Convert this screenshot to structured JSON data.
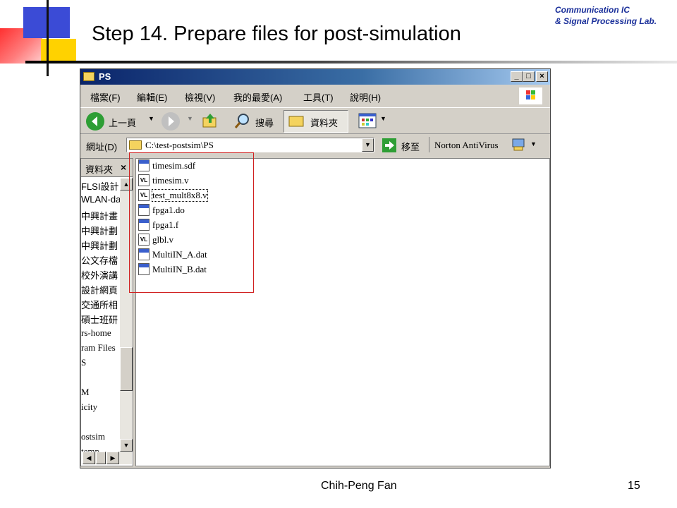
{
  "slide": {
    "title": "Step 14.  Prepare files for post-simulation",
    "lab_line1": "Communication IC",
    "lab_line2": "& Signal Processing Lab.",
    "author": "Chih-Peng Fan",
    "page_number": "15"
  },
  "window": {
    "title": "PS",
    "minimize": "_",
    "maximize": "□",
    "close": "×",
    "menu": [
      "檔案(F)",
      "編輯(E)",
      "檢視(V)",
      "我的最愛(A)",
      "工具(T)",
      "說明(H)"
    ],
    "toolbar": {
      "back": "上一頁",
      "search": "搜尋",
      "folders": "資料夾"
    },
    "address": {
      "label": "網址(D)",
      "value": "C:\\test-postsim\\PS",
      "go": "移至",
      "antivirus": "Norton AntiVirus"
    }
  },
  "left_pane": {
    "header": "資料夾",
    "items": [
      "FLSI設計",
      "WLAN-da",
      "中興計畫",
      "中興計劃",
      "中興計劃",
      "公文存檔",
      "校外演講",
      "設計網頁",
      "交通所相",
      "碩士班研",
      "rs-home",
      "ram Files",
      "S",
      "",
      "M",
      "icity",
      "",
      "ostsim",
      "temp"
    ]
  },
  "files": [
    {
      "name": "timesim.sdf",
      "icon": "dat-file-icon"
    },
    {
      "name": "timesim.v",
      "icon": "verilog-file-icon"
    },
    {
      "name": "test_mult8x8.v",
      "icon": "verilog-file-icon"
    },
    {
      "name": "fpga1.do",
      "icon": "dat-file-icon"
    },
    {
      "name": "fpga1.f",
      "icon": "dat-file-icon"
    },
    {
      "name": "glbl.v",
      "icon": "verilog-file-icon"
    },
    {
      "name": "MultiIN_A.dat",
      "icon": "dat-file-icon"
    },
    {
      "name": "MultiIN_B.dat",
      "icon": "dat-file-icon"
    }
  ],
  "colors": {
    "title_bar": "#0a246a",
    "highlight_box": "#d02020",
    "lab_text": "#1a2f9a"
  }
}
